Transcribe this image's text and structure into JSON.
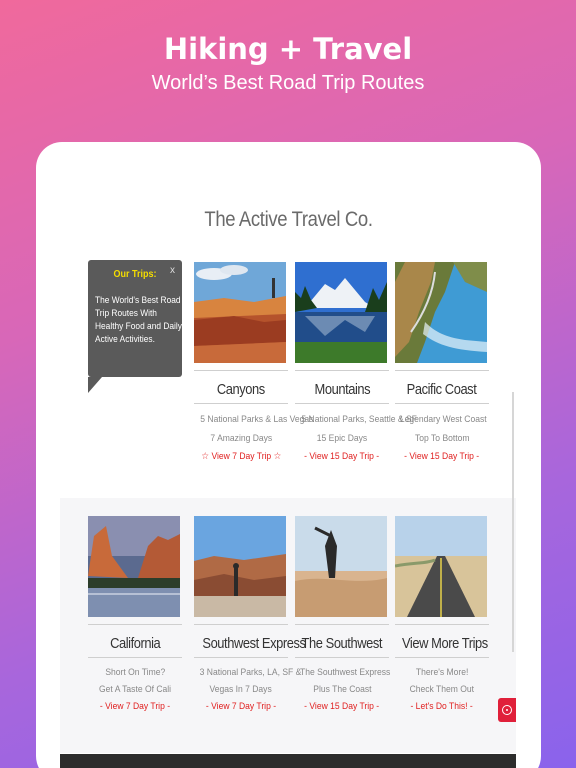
{
  "promo": {
    "title": "Hiking + Travel",
    "subtitle": "World’s Best Road Trip Routes"
  },
  "site": {
    "title": "The Active Travel Co."
  },
  "tooltip": {
    "heading": "Our Trips:",
    "text": "The World's Best Road Trip Routes With Healthy Food and Daily Active Activities.",
    "close": "x"
  },
  "trips_row1": [
    {
      "name": "Canyons",
      "line1": "5 National Parks & Las Vegas",
      "line2": "7 Amazing Days",
      "link": "☆ View 7 Day Trip ☆",
      "photo": "canyon-photo"
    },
    {
      "name": "Mountains",
      "line1": "5 National Parks, Seattle & SF",
      "line2": "15 Epic Days",
      "link": "- View 15 Day Trip -",
      "photo": "mountain-lake-photo"
    },
    {
      "name": "Pacific Coast",
      "line1": "Legendary West Coast",
      "line2": "Top To Bottom",
      "link": "- View 15 Day Trip -",
      "photo": "coast-photo"
    }
  ],
  "trips_row2": [
    {
      "name": "California",
      "line1": "Short On Time?",
      "line2": "Get A Taste Of Cali",
      "link": "- View 7 Day Trip -",
      "photo": "yosemite-photo"
    },
    {
      "name": "Southwest Express",
      "line1": "3 National Parks, LA, SF &",
      "line2": "Vegas In 7 Days",
      "link": "- View 7 Day Trip -",
      "photo": "grand-canyon-photo"
    },
    {
      "name": "The Southwest",
      "line1": "The Southwest Express",
      "line2": "Plus The Coast",
      "link": "- View 15 Day Trip -",
      "photo": "desert-yoga-photo"
    },
    {
      "name": "View More Trips",
      "line1": "There's More!",
      "line2": "Check Them Out",
      "link": "- Let's Do This! -",
      "photo": "desert-road-photo"
    }
  ],
  "colors": {
    "accent_red": "#e02020",
    "tooltip_yellow": "#f4dd00",
    "gradient_start": "#f0699c",
    "gradient_end": "#8a63ec"
  },
  "icons": {
    "chat": "chat-bubble-icon"
  }
}
